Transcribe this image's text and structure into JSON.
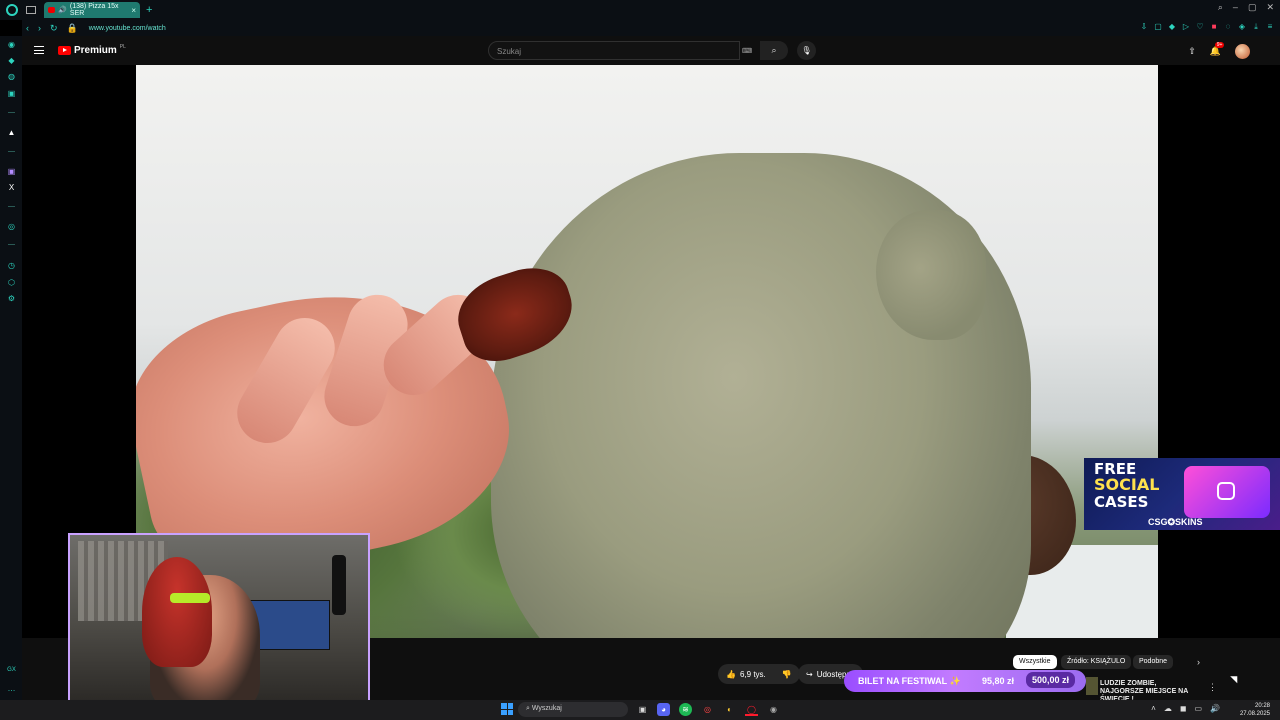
{
  "browser": {
    "tab_title": "(138) Pizza 15x SER",
    "url": "www.youtube.com/watch"
  },
  "youtube": {
    "logo_text": "Premium",
    "logo_region": "PL",
    "search_placeholder": "Szukaj",
    "notification_count": "9+"
  },
  "ad": {
    "line1": "FREE",
    "line2": "SOCIAL",
    "line3": "CASES",
    "brand": "CSG✪SKINS"
  },
  "actions": {
    "likes": "6,9 tys.",
    "share": "Udostępnij"
  },
  "chips": [
    "Wszystkie",
    "Źródło: KSIĄŻULO",
    "Podobne"
  ],
  "recommended": {
    "title": "LUDZIE ZOMBIE, NAJGORSZE MIEJSCE NA ŚWIECIE !"
  },
  "donation_goal": {
    "label": "BILET NA FESTIWAL ✨",
    "current": "95,80 zł",
    "separator": "/",
    "target": "500,00 zł",
    "progress_fraction": 0.19
  },
  "taskbar": {
    "search_label": "Wyszukaj",
    "time": "20:28",
    "date": "27.08.2025"
  }
}
